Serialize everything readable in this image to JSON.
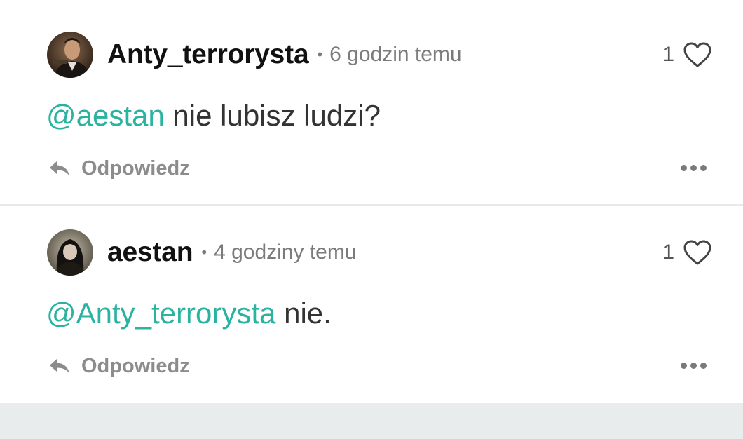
{
  "comments": [
    {
      "username": "Anty_terrorysta",
      "separator": "•",
      "time": "6 godzin temu",
      "likes": "1",
      "mention": "@aestan",
      "text": " nie lubisz ludzi?",
      "reply_label": "Odpowiedz"
    },
    {
      "username": "aestan",
      "separator": "•",
      "time": "4 godziny temu",
      "likes": "1",
      "mention": "@Anty_terrorysta",
      "text": " nie.",
      "reply_label": "Odpowiedz"
    }
  ],
  "icons": {
    "like": "heart-icon",
    "reply": "reply-arrow-icon",
    "more": "more-dots-icon"
  },
  "colors": {
    "mention": "#2bb3a1",
    "username": "#111111",
    "meta": "#7b7b7b",
    "footer_bg": "#e9ecec"
  }
}
